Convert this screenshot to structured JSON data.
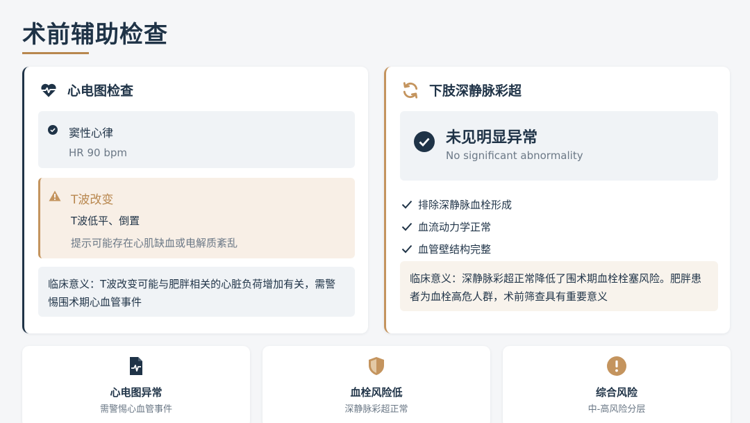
{
  "page": {
    "title": "术前辅助检查"
  },
  "ecg": {
    "title": "心电图检查",
    "sinus": {
      "label": "窦性心律",
      "value": "HR 90 bpm"
    },
    "twave": {
      "label": "T波改变",
      "line1": "T波低平、倒置",
      "line2": "提示可能存在心肌缺血或电解质紊乱"
    },
    "clinical": "临床意义：T波改变可能与肥胖相关的心脏负荷增加有关，需警惕围术期心血管事件"
  },
  "dvt": {
    "title": "下肢深静脉彩超",
    "result_main": "未见明显异常",
    "result_en": "No significant abnormality",
    "items": [
      "排除深静脉血栓形成",
      "血流动力学正常",
      "血管壁结构完整"
    ],
    "clinical": "临床意义：深静脉彩超正常降低了围术期血栓栓塞风险。肥胖患者为血栓高危人群，术前筛查具有重要意义"
  },
  "summary": [
    {
      "title": "心电图异常",
      "subtitle": "需警惕心血管事件",
      "icon": "file-waveform-icon"
    },
    {
      "title": "血栓风险低",
      "subtitle": "深静脉彩超正常",
      "icon": "shield-icon"
    },
    {
      "title": "综合风险",
      "subtitle": "中-高风险分层",
      "icon": "exclamation-circle-icon"
    }
  ],
  "colors": {
    "navy": "#1f3347",
    "accent": "#c4945e",
    "muted": "#6b7886",
    "panel": "#f0f3f6",
    "warn_bg": "#f8efe6"
  }
}
